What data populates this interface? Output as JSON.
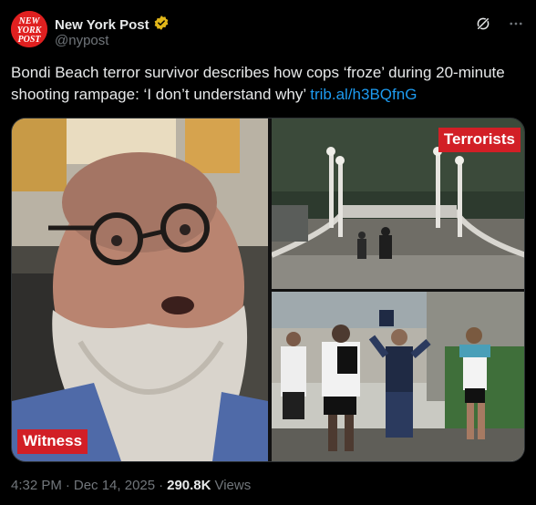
{
  "account": {
    "display_name": "New York Post",
    "handle": "@nypost",
    "avatar_text": [
      "NEW",
      "YORK",
      "POST"
    ],
    "avatar_color": "#e02020",
    "verified_badge_color": "#e2b719"
  },
  "header_actions": {
    "grok_icon": "grok-icon",
    "more_icon": "more-icon"
  },
  "tweet": {
    "text": "Bondi Beach terror survivor describes how cops ‘froze’ during 20-minute shooting rampage: ‘I don’t understand why’ ",
    "link_text": "trib.al/h3BQfnG",
    "link_color": "#1d9bf0"
  },
  "media": {
    "left_label": "Witness",
    "top_right_label": "Terrorists",
    "label_color": "#d21f26"
  },
  "meta": {
    "time": "4:32 PM",
    "separator": "·",
    "date": "Dec 14, 2025",
    "views_count": "290.8K",
    "views_label": "Views"
  }
}
